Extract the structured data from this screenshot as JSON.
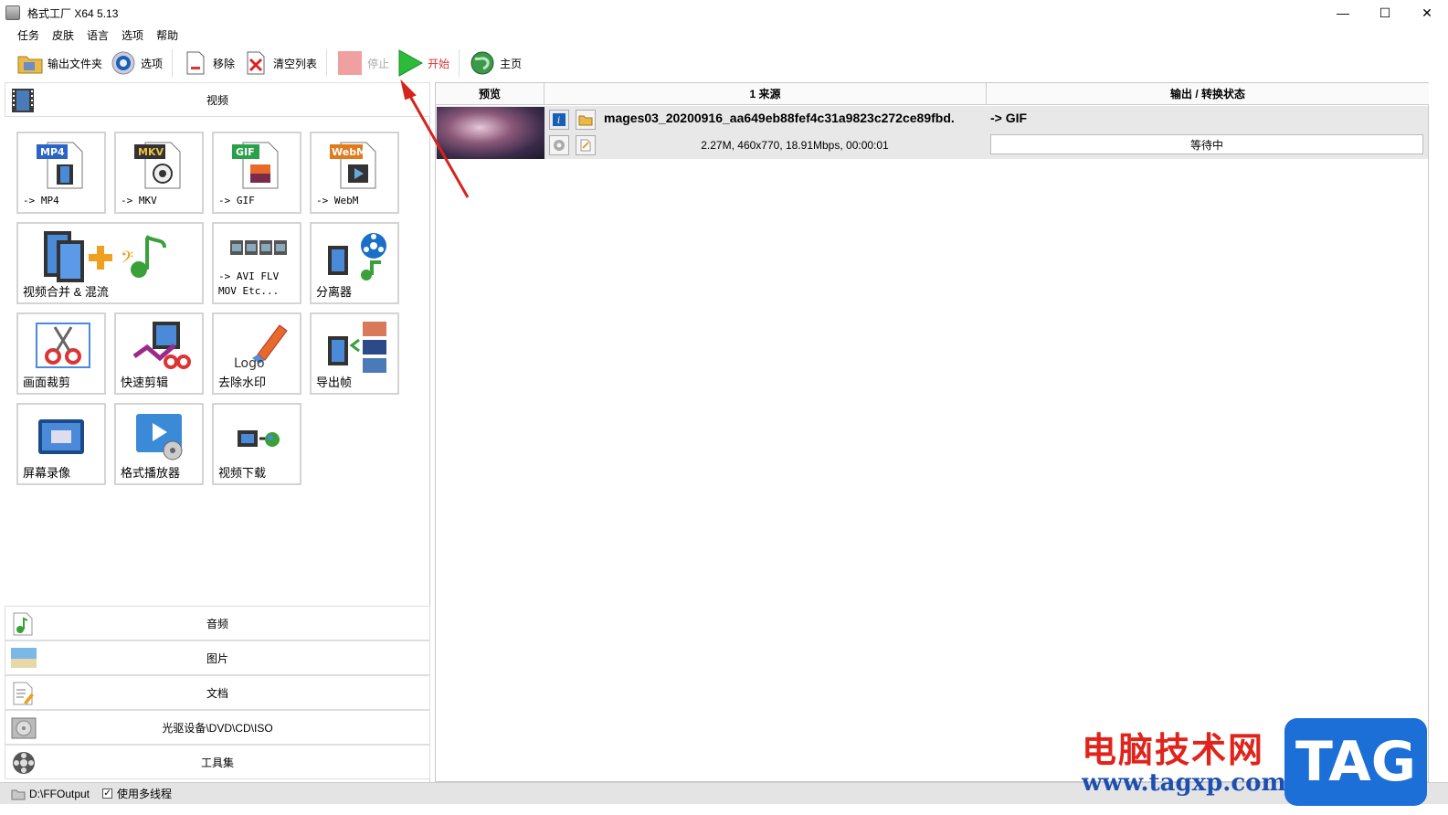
{
  "window": {
    "title": "格式工厂 X64 5.13",
    "minimize": "—",
    "maximize": "☐",
    "close": "✕"
  },
  "menu": [
    "任务",
    "皮肤",
    "语言",
    "选项",
    "帮助"
  ],
  "toolbar": {
    "output_folder": "输出文件夹",
    "options": "选项",
    "remove": "移除",
    "clear_list": "清空列表",
    "stop": "停止",
    "start": "开始",
    "home": "主页"
  },
  "left": {
    "video_header": "视频",
    "tiles": [
      {
        "label": "-> MP4",
        "badge": "MP4",
        "badge_color": "#2a64c8"
      },
      {
        "label": "-> MKV",
        "badge": "MKV",
        "badge_color": "#333333"
      },
      {
        "label": "-> GIF",
        "badge": "GIF",
        "badge_color": "#2ba04a"
      },
      {
        "label": "-> WebM",
        "badge": "WebM",
        "badge_color": "#e07a1c"
      },
      {
        "label": "视频合并 & 混流"
      },
      {
        "label_line1": "-> AVI FLV",
        "label_line2": "MOV Etc..."
      },
      {
        "label": "分离器"
      },
      {
        "label": "画面裁剪"
      },
      {
        "label": "快速剪辑"
      },
      {
        "label": "去除水印",
        "art_text": "Logo"
      },
      {
        "label": "导出帧"
      },
      {
        "label": "屏幕录像"
      },
      {
        "label": "格式播放器"
      },
      {
        "label": "视频下载"
      }
    ],
    "categories": [
      "音频",
      "图片",
      "文档",
      "光驱设备\\DVD\\CD\\ISO",
      "工具集"
    ]
  },
  "list": {
    "headers": {
      "preview": "预览",
      "source": "1 来源",
      "output": "输出 / 转换状态"
    },
    "rows": [
      {
        "filename": "mages03_20200916_aa649eb88fef4c31a9823c272ce89fbd.",
        "meta": "2.27M, 460x770, 18.91Mbps, 00:00:01",
        "output": "-> GIF",
        "status": "等待中"
      }
    ]
  },
  "statusbar": {
    "output_path": "D:\\FFOutput",
    "multithread": "使用多线程"
  },
  "watermark": {
    "cn": "电脑技术网",
    "url": "www.tagxp.com",
    "tag": "TAG"
  },
  "colors": {
    "start_green": "#2dbb3a",
    "arrow_red": "#d6231b",
    "stop_pink": "#f0a0a0"
  }
}
